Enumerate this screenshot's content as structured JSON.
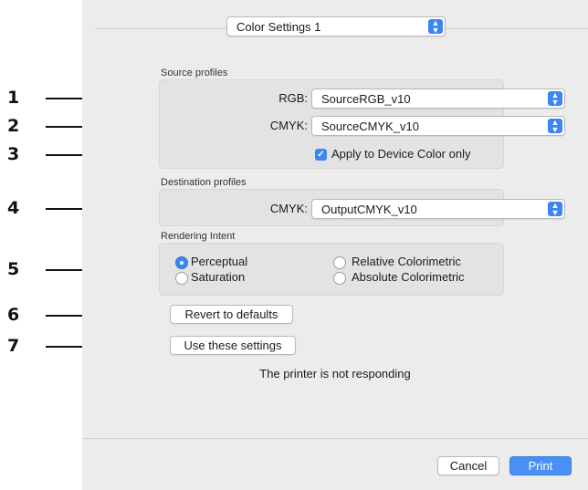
{
  "preset_popup": {
    "value": "Color Settings 1"
  },
  "source": {
    "section_label": "Source profiles",
    "rgb": {
      "label": "RGB:",
      "value": "SourceRGB_v10"
    },
    "cmyk": {
      "label": "CMYK:",
      "value": "SourceCMYK_v10"
    },
    "apply_checkbox": {
      "label": "Apply to Device Color only",
      "checked": true
    }
  },
  "destination": {
    "section_label": "Destination profiles",
    "cmyk": {
      "label": "CMYK:",
      "value": "OutputCMYK_v10"
    }
  },
  "rendering": {
    "section_label": "Rendering Intent",
    "options": [
      {
        "label": "Perceptual",
        "selected": true
      },
      {
        "label": "Relative Colorimetric",
        "selected": false
      },
      {
        "label": "Saturation",
        "selected": false
      },
      {
        "label": "Absolute Colorimetric",
        "selected": false
      }
    ]
  },
  "buttons": {
    "revert": "Revert to defaults",
    "use": "Use these settings",
    "cancel": "Cancel",
    "print": "Print"
  },
  "status_text": "The printer is not responding",
  "callouts": [
    "1",
    "2",
    "3",
    "4",
    "5",
    "6",
    "7"
  ],
  "colors": {
    "accent": "#3b86f3",
    "panel": "#ececec",
    "group": "#e3e3e3"
  }
}
